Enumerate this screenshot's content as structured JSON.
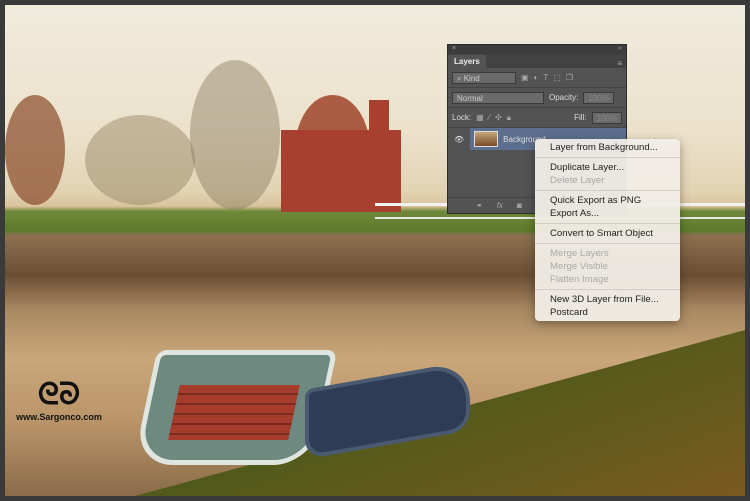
{
  "watermark": {
    "text": "www.Sargonco.com"
  },
  "layers_panel": {
    "close": "×",
    "collapse": "‹‹",
    "tab": "Layers",
    "menu_icon": "panel-menu-icon",
    "filter_kind": "Kind",
    "blend_mode": "Normal",
    "opacity_label": "Opacity:",
    "opacity_value": "100%",
    "lock_label": "Lock:",
    "fill_label": "Fill:",
    "fill_value": "100%",
    "layers": [
      {
        "name": "Background",
        "visible": true,
        "selected": true
      }
    ]
  },
  "context_menu": {
    "groups": [
      [
        {
          "label": "Layer from Background...",
          "enabled": true
        }
      ],
      [
        {
          "label": "Duplicate Layer...",
          "enabled": true
        },
        {
          "label": "Delete Layer",
          "enabled": false
        }
      ],
      [
        {
          "label": "Quick Export as PNG",
          "enabled": true
        },
        {
          "label": "Export As...",
          "enabled": true
        }
      ],
      [
        {
          "label": "Convert to Smart Object",
          "enabled": true
        }
      ],
      [
        {
          "label": "Merge Layers",
          "enabled": false
        },
        {
          "label": "Merge Visible",
          "enabled": false
        },
        {
          "label": "Flatten Image",
          "enabled": false
        }
      ],
      [
        {
          "label": "New 3D Layer from File...",
          "enabled": true
        },
        {
          "label": "Postcard",
          "enabled": true
        }
      ]
    ]
  }
}
